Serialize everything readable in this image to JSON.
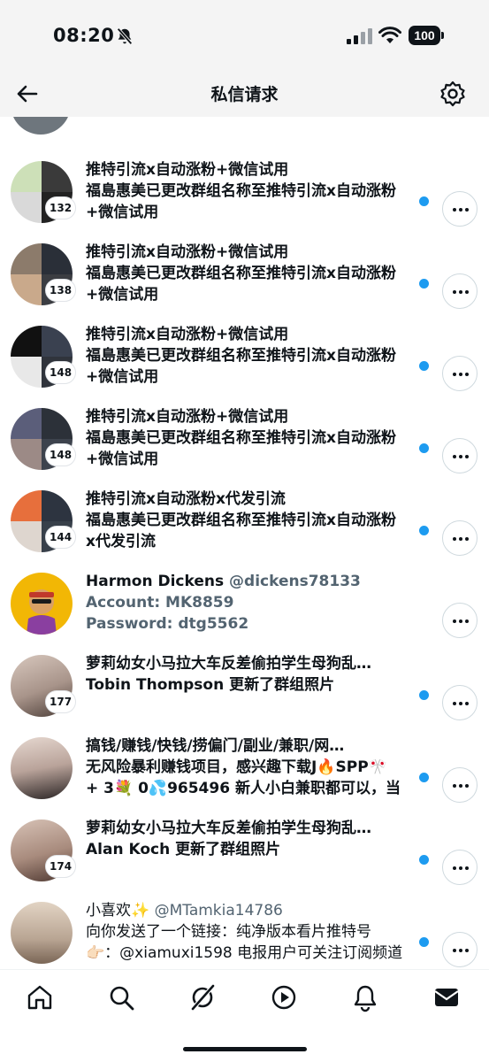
{
  "status_bar": {
    "time": "08:20",
    "battery": "100"
  },
  "header": {
    "title": "私信请求"
  },
  "conversations": [
    {
      "avatar_colors": [
        "#cde0b8",
        "#3a3a3a",
        "#d9d9d9",
        "#222222"
      ],
      "badge": "132",
      "line1": "推特引流x自动涨粉+微信试用",
      "line2": "福島惠美已更改群组名称至推特引流x自动涨粉",
      "line3": "+微信试用",
      "unread": true
    },
    {
      "avatar_colors": [
        "#8c7b6b",
        "#2a2f38",
        "#c9a98b",
        "#3b3d42"
      ],
      "badge": "138",
      "line1": "推特引流x自动涨粉+微信试用",
      "line2": "福島惠美已更改群组名称至推特引流x自动涨粉",
      "line3": "+微信试用",
      "unread": true
    },
    {
      "avatar_colors": [
        "#111111",
        "#3a4150",
        "#e8e8e8",
        "#30343c"
      ],
      "badge": "148",
      "line1": "推特引流x自动涨粉+微信试用",
      "line2": "福島惠美已更改群组名称至推特引流x自动涨粉",
      "line3": "+微信试用",
      "unread": true
    },
    {
      "avatar_colors": [
        "#5b5e7a",
        "#2c3139",
        "#9c8a86",
        "#3d434d"
      ],
      "badge": "148",
      "line1": "推特引流x自动涨粉+微信试用",
      "line2": "福島惠美已更改群组名称至推特引流x自动涨粉",
      "line3": "+微信试用",
      "unread": true
    },
    {
      "avatar_colors": [
        "#e76f3c",
        "#2d3440",
        "#ded6cf",
        "#38404a"
      ],
      "badge": "144",
      "line1": "推特引流x自动涨粉x代发引流",
      "line2": "福島惠美已更改群组名称至推特引流x自动涨粉",
      "line3": "x代发引流",
      "unread": true
    },
    {
      "avatar_colors": [
        "#f2b705",
        "#f2b705",
        "#8a3fa0",
        "#8a3fa0"
      ],
      "badge": "",
      "name": "Harmon Dickens",
      "handle": "@dickens78133",
      "line2": "Account: MK8859",
      "line3": "Password: dtg5562",
      "unread": false
    },
    {
      "avatar_colors": [
        "#c7b7ad",
        "#c7b7ad",
        "#6d5d55",
        "#6d5d55"
      ],
      "badge": "177",
      "line1": "萝莉幼女小马拉大车反差偷拍学生母狗乱…",
      "name": "Tobin Thompson",
      "line2_suffix": " 更新了群组照片",
      "unread": true
    },
    {
      "avatar_colors": [
        "#d9c9c2",
        "#d9c9c2",
        "#2a2424",
        "#2a2424"
      ],
      "badge": "",
      "line1": "搞钱/赚钱/快钱/捞偏门/副业/兼职/网…",
      "line2": "无风险暴利赚钱项目，感兴趣下载J🔥SPP🎌",
      "line3": "+ 3💐 0💦965496  新人小白兼职都可以，当",
      "unread": true
    },
    {
      "avatar_colors": [
        "#c9b2a6",
        "#c9b2a6",
        "#5a4038",
        "#5a4038"
      ],
      "badge": "174",
      "line1": "萝莉幼女小马拉大车反差偷拍学生母狗乱…",
      "name": "Alan Koch",
      "line2_suffix": " 更新了群组照片",
      "unread": true
    },
    {
      "avatar_colors": [
        "#d8c8b6",
        "#d8c8b6",
        "#8b7666",
        "#8b7666"
      ],
      "badge": "",
      "name": "小喜欢✨",
      "handle": "@MTamkia14786",
      "line2": "向你发送了一个链接：纯净版本看片推特号",
      "line3": "👉🏻：@xiamuxi1598 电报用户可关注订阅频道",
      "unread": true
    }
  ],
  "tab_bar": {
    "items": [
      "home-icon",
      "search-icon",
      "grok-icon",
      "video-icon",
      "notifications-icon",
      "messages-icon"
    ],
    "active": "messages-icon"
  }
}
